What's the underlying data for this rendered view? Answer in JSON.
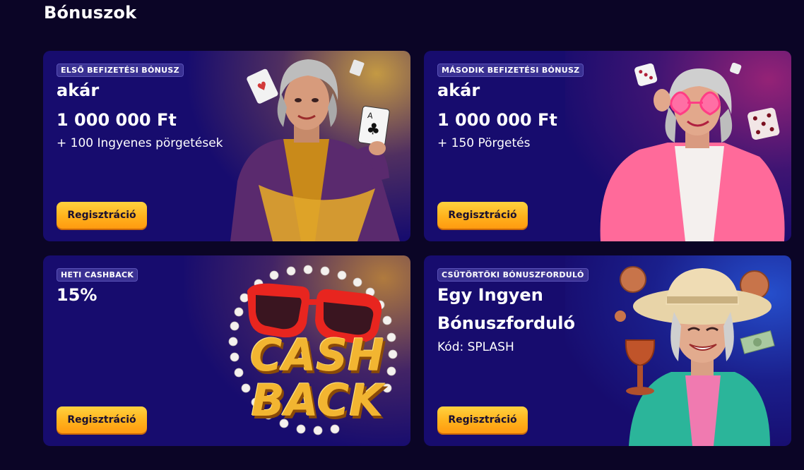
{
  "page": {
    "title": "Bónuszok"
  },
  "cards": [
    {
      "badge": "ELSŐ BEFIZETÉSI BÓNUSZ",
      "line1": "akár",
      "line2": "1 000 000 Ft",
      "line3": "+ 100 Ingyenes pörgetések",
      "button": "Regisztráció",
      "artwork": "woman-with-playing-cards"
    },
    {
      "badge": "MÁSODIK BEFIZETÉSI BÓNUSZ",
      "line1": "akár",
      "line2": "1 000 000 Ft",
      "line3": "+ 150 Pörgetés",
      "button": "Regisztráció",
      "artwork": "woman-with-heart-glasses-and-dice"
    },
    {
      "badge": "HETI CASHBACK",
      "line1": "15%",
      "button": "Regisztráció",
      "artwork": "sunglasses-pearls-cashback",
      "art_text": [
        "CASH",
        "BACK"
      ]
    },
    {
      "badge": "CSÜTÖRTÖKI BÓNUSZFORDULÓ",
      "line1": "Egy Ingyen",
      "line2": "Bónuszforduló",
      "line3": "Kód: SPLASH",
      "button": "Regisztráció",
      "artwork": "woman-with-hat-and-trophy"
    }
  ],
  "colors": {
    "background": "#0b0526",
    "card": "#170c6e",
    "button": "#ffb21c",
    "badge": "#3a3193"
  }
}
